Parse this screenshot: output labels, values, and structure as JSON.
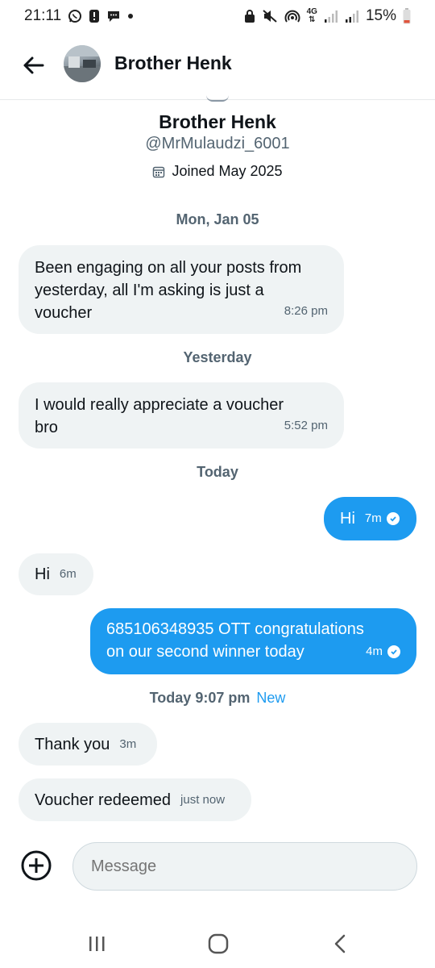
{
  "status_bar": {
    "time": "21:11",
    "network": "4G",
    "battery": "15%"
  },
  "header": {
    "name": "Brother Henk"
  },
  "profile": {
    "name": "Brother Henk",
    "handle": "@MrMulaudzi_6001",
    "joined": "Joined May 2025"
  },
  "separators": {
    "s1": "Mon, Jan 05",
    "s2": "Yesterday",
    "s3": "Today",
    "s4": "Today 9:07 pm",
    "s4_new": "New"
  },
  "messages": {
    "m1": {
      "line1": "Been engaging on all your posts from",
      "line2": "yesterday, all I'm asking is just a",
      "line3": "voucher",
      "time": "8:26 pm"
    },
    "m2": {
      "line1": "I would really appreciate a voucher",
      "line2": "bro",
      "time": "5:52 pm"
    },
    "m3": {
      "text": "Hi",
      "time": "7m"
    },
    "m4": {
      "text": "Hi",
      "time": "6m"
    },
    "m5": {
      "line1": "685106348935  OTT congratulations",
      "line2": "on our second winner today",
      "time": "4m"
    },
    "m6": {
      "text": "Thank you",
      "time": "3m"
    },
    "m7": {
      "text": "Voucher redeemed",
      "time": "just now"
    }
  },
  "composer": {
    "placeholder": "Message"
  },
  "colors": {
    "accent": "#1d9bf0",
    "incoming_bubble": "#eff3f4",
    "secondary_text": "#536471"
  },
  "icons": [
    "back-arrow-icon",
    "calendar-icon",
    "check-circle-icon",
    "plus-circle-icon",
    "recents-icon",
    "home-icon",
    "nav-back-icon"
  ]
}
